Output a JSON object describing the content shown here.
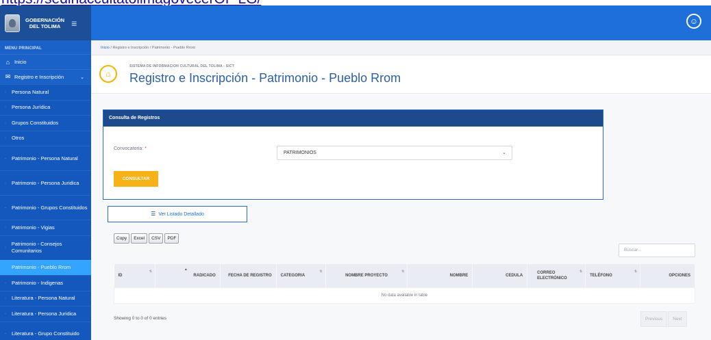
{
  "browser": {
    "url_fragment": "https://sedinaccultatolimagovecerOF LG/"
  },
  "brand": {
    "line1": "GOBERNACIÓN",
    "line2": "DEL TOLIMA",
    "menu_icon": "hamburger-icon"
  },
  "sidebar": {
    "header": "MENU PRINCIPAL",
    "home": {
      "label": "Inicio",
      "icon": "home-icon"
    },
    "section": {
      "label": "Registro e Inscripción",
      "icon": "mail-icon",
      "expanded": true
    },
    "items": [
      {
        "label": "Persona Natural",
        "active": false
      },
      {
        "label": "Persona Jurídica",
        "active": false
      },
      {
        "label": "Grupos Constituidos",
        "active": false
      },
      {
        "label": "Otros",
        "active": false
      },
      {
        "label": "Patrimonio - Persona Natural",
        "active": false
      },
      {
        "label": "Patrimonio - Persona Juridica",
        "active": false
      },
      {
        "label": "Patrimonio - Grupos Constituidos",
        "active": false
      },
      {
        "label": "Patrimonio - Vigias",
        "active": false
      },
      {
        "label": "Patrimonio - Consejos Comunitarios",
        "active": false
      },
      {
        "label": "Patrimonio - Pueblo Rrom",
        "active": true
      },
      {
        "label": "Patrimonio - Indigenas",
        "active": false
      },
      {
        "label": "Literatura - Persona Natural",
        "active": false
      },
      {
        "label": "Literatura - Persona Juridica",
        "active": false
      },
      {
        "label": "Literatura - Grupo Constituido",
        "active": false
      }
    ]
  },
  "topbar": {
    "user_icon": "user-circle-icon"
  },
  "breadcrumb": {
    "home": "Inicio",
    "separator": " / ",
    "path": "Registro e Inscripción / Patrimonio - Pueblo Rrom"
  },
  "header": {
    "subtitle": "SISTEMA DE INFORMACION CULTURAL DEL TOLIMA - SICT",
    "title": "Registro e Inscripción - Patrimonio - Pueblo Rrom",
    "icon": "home-badge-icon"
  },
  "form": {
    "card_title": "Consulta de Registros",
    "convocatoria_label": "Convocatoria:",
    "required_mark": "*",
    "convocatoria_value": "PATRIMONIOS",
    "consultar": "CONSULTAR"
  },
  "listado_button": "Ver Listado Detallado",
  "export_buttons": [
    "Copy",
    "Excel",
    "CSV",
    "PDF"
  ],
  "search": {
    "placeholder": "Buscar..."
  },
  "table": {
    "columns": [
      "ID",
      "RADICADO",
      "FECHA DE REGISTRO",
      "CATEGORIA",
      "NOMBRE PROYECTO",
      "NOMBRE",
      "CEDULA",
      "CORREO ELECTRÓNICO",
      "TELÉFONO",
      "OPCIONES"
    ],
    "empty_message": "No data available in table"
  },
  "footer": {
    "info": "Showing 0 to 0 of 0 entries",
    "previous": "Previous",
    "next": "Next"
  },
  "colors": {
    "sidebar": "#1b62c8",
    "brand": "#1d4f98",
    "topbar": "#1e6fd9",
    "active_item": "#33a4ff",
    "accent": "#f7b217",
    "card_header": "#1c4a8d"
  }
}
